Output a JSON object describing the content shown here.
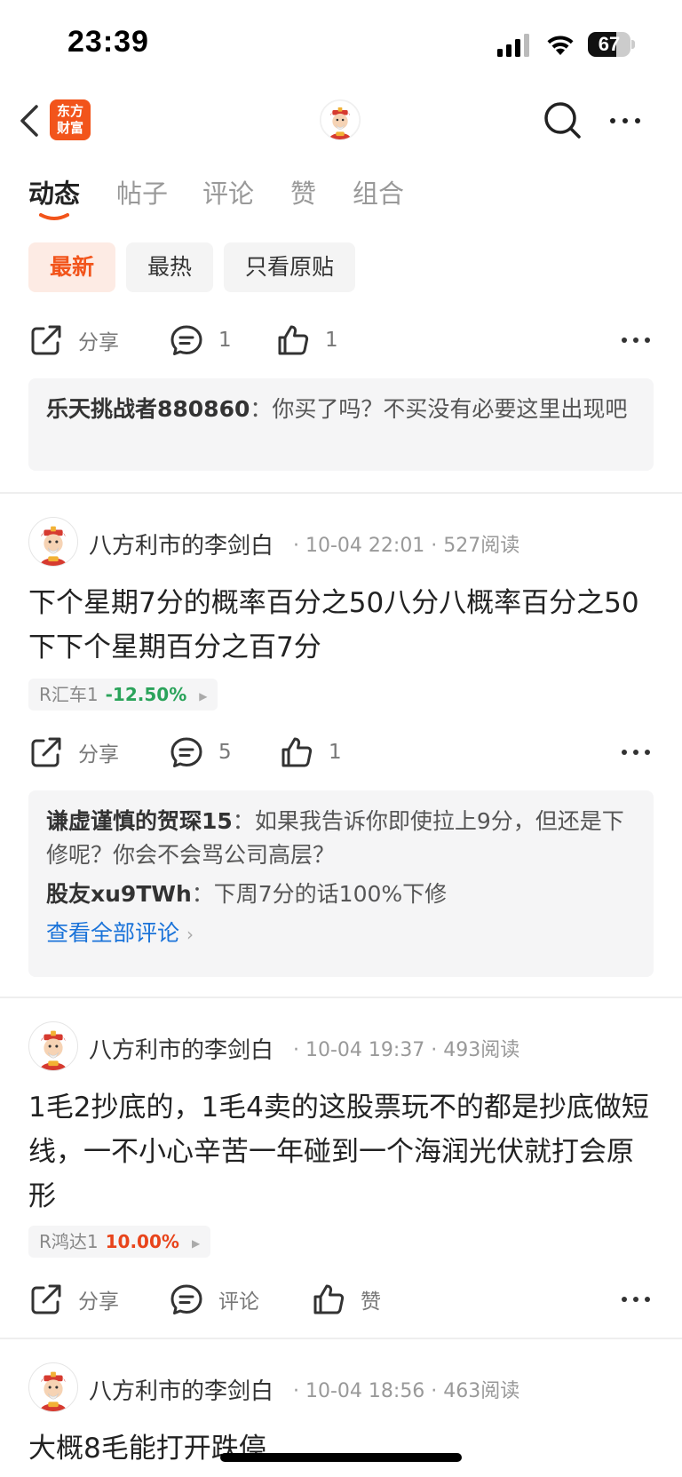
{
  "status_bar": {
    "time": "23:39",
    "battery": "67",
    "battery_level": 0.67
  },
  "nav": {
    "logo_text_line1": "东方",
    "logo_text_line2": "财富"
  },
  "tabs": [
    {
      "label": "动态",
      "active": true
    },
    {
      "label": "帖子"
    },
    {
      "label": "评论"
    },
    {
      "label": "赞"
    },
    {
      "label": "组合"
    }
  ],
  "filters": [
    {
      "label": "最新",
      "active": true
    },
    {
      "label": "最热"
    },
    {
      "label": "只看原贴"
    }
  ],
  "accent_color": "#f2541b",
  "share_label": "分享",
  "top_item": {
    "comment_count": "1",
    "like_count": "1",
    "comments": [
      {
        "user": "乐天挑战者880860",
        "sep": "：",
        "text": "你买了吗？不买没有必要这里出现吧"
      }
    ]
  },
  "posts": [
    {
      "author": "八方利市的李剑白",
      "meta": "· 10-04 22:01 · 527阅读",
      "text": "下个星期7分的概率百分之50八分八概率百分之50下下个星期百分之百7分",
      "stock": {
        "name": "R汇车1",
        "change": "-12.50%",
        "color": "#2aa35a"
      },
      "comment_label": "5",
      "like_label": "1",
      "comments": [
        {
          "user": "谦虚谨慎的贺琛15",
          "sep": "：",
          "text": "如果我告诉你即使拉上9分，但还是下修呢？你会不会骂公司高层？"
        },
        {
          "user": "股友xu9TWh",
          "sep": "：",
          "text": "下周7分的话100%下修"
        }
      ],
      "view_all": "查看全部评论"
    },
    {
      "author": "八方利市的李剑白",
      "meta": "· 10-04 19:37 · 493阅读",
      "text": "1毛2抄底的，1毛4卖的这股票玩不的都是抄底做短线，一不小心辛苦一年碰到一个海润光伏就打会原形",
      "stock": {
        "name": "R鸿达1",
        "change": "10.00%",
        "color": "#e8441b"
      },
      "comment_label": "评论",
      "like_label": "赞"
    },
    {
      "author": "八方利市的李剑白",
      "meta": "· 10-04 18:56 · 463阅读",
      "text": "大概8毛能打开跌停"
    }
  ]
}
